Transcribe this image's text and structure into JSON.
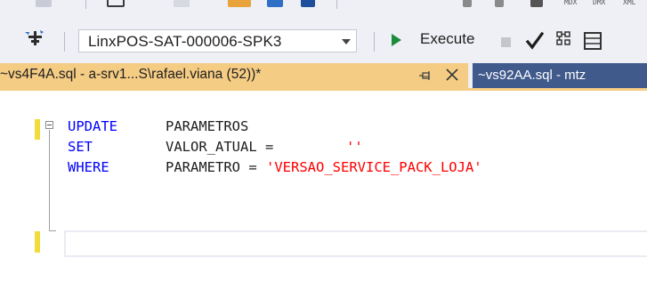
{
  "toolbar": {
    "database_selector": {
      "value": "LinxPOS-SAT-000006-SPK3"
    },
    "execute_label": "Execute"
  },
  "tabs": [
    {
      "title": "~vs4F4A.sql - a-srv1...S\\rafael.viana (52))*",
      "active": true
    },
    {
      "title": "~vs92AA.sql - mtz",
      "active": false
    }
  ],
  "editor": {
    "lines": [
      {
        "keyword": "UPDATE",
        "text": "PARAMETROS",
        "string": ""
      },
      {
        "keyword": "SET",
        "text": "VALOR_ATUAL = ",
        "string": "''"
      },
      {
        "keyword": "WHERE",
        "text": "PARAMETRO = ",
        "string": "'VERSAO_SERVICE_PACK_LOJA'"
      }
    ]
  },
  "colors": {
    "active_tab": "#f5cc84",
    "inactive_tab": "#415a8c",
    "keyword": "#0000ff",
    "string": "#ff0000",
    "change_margin": "#f2dc3c"
  },
  "icons": [
    "connect-icon",
    "chevron-down-icon",
    "execute-play-icon",
    "stop-icon",
    "check-icon",
    "results-grid-icon",
    "pin-icon",
    "close-icon",
    "collapse-icon"
  ]
}
